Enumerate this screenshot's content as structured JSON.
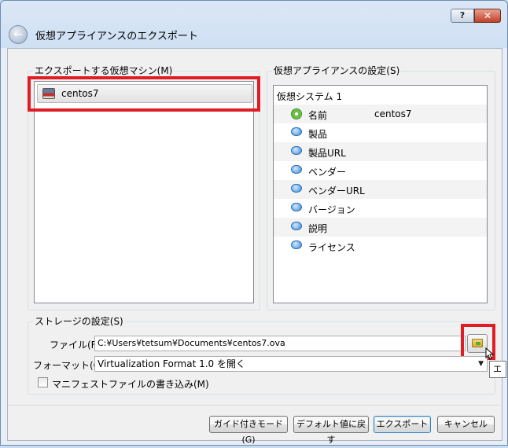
{
  "window": {
    "title": "仮想アプライアンスのエクスポート",
    "help_label": "?",
    "close_label": "✕",
    "back_glyph": "←"
  },
  "vm_group": {
    "title": "エクスポートする仮想マシン(M)",
    "items": [
      {
        "label": "centos7"
      }
    ]
  },
  "settings_group": {
    "title": "仮想アプライアンスの設定(S)",
    "system_label": "仮想システム 1",
    "rows": [
      {
        "label": "名前",
        "value": "centos7",
        "icon": "name-icon"
      },
      {
        "label": "製品",
        "value": "",
        "icon": "speech-bubble-icon"
      },
      {
        "label": "製品URL",
        "value": "",
        "icon": "speech-bubble-icon"
      },
      {
        "label": "ベンダー",
        "value": "",
        "icon": "speech-bubble-icon"
      },
      {
        "label": "ベンダーURL",
        "value": "",
        "icon": "speech-bubble-icon"
      },
      {
        "label": "バージョン",
        "value": "",
        "icon": "speech-bubble-icon"
      },
      {
        "label": "説明",
        "value": "",
        "icon": "speech-bubble-icon"
      },
      {
        "label": "ライセンス",
        "value": "",
        "icon": "speech-bubble-icon"
      }
    ]
  },
  "storage_group": {
    "title": "ストレージの設定(S)",
    "file_label": "ファイル(F):",
    "file_value": "C:¥Users¥tetsum¥Documents¥centos7.ova",
    "format_label": "フォーマット(O):",
    "format_value": "Virtualization Format 1.0 を開く",
    "manifest_label": "マニフェストファイルの書き込み(M)",
    "tooltip_text": "エク"
  },
  "buttons": {
    "guided": "ガイド付きモード(G)",
    "defaults": "デフォルト値に戻す",
    "export": "エクスポート",
    "cancel": "キャンセル"
  },
  "colors": {
    "highlight_red": "#e01c24"
  }
}
